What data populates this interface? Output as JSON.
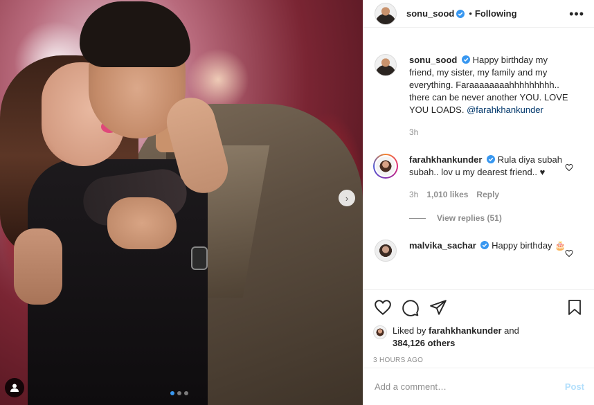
{
  "colors": {
    "link": "#00376b",
    "verified": "#3897f0",
    "post_button_disabled": "#b2dffc",
    "muted_text": "#8e8e8e"
  },
  "photo": {
    "carousel_dots": 3,
    "active_dot": 0,
    "next_icon": "chevron-right-icon",
    "tag_icon": "user-tag-icon"
  },
  "header": {
    "username": "sonu_sood",
    "separator": "•",
    "follow_status": "Following",
    "more_icon": "more-options-icon"
  },
  "caption": {
    "username": "sonu_sood",
    "text": "Happy birthday my friend, my sister, my family and my everything. Faraaaaaaaahhhhhhhhh.. there can be never another YOU. LOVE YOU LOADS.",
    "mention": "@farahkhankunder",
    "time": "3h"
  },
  "comments": [
    {
      "username": "farahkhankunder",
      "text": "Rula diya subah subah.. lov u my dearest friend.. ♥",
      "time": "3h",
      "likes": "1,010 likes",
      "reply_label": "Reply",
      "view_replies": "View replies (51)"
    },
    {
      "username": "malvika_sachar",
      "text": "Happy birthday 🎂"
    }
  ],
  "likes": {
    "prefix": "Liked by",
    "by_user": "farahkhankunder",
    "and": "and",
    "others": "384,126 others"
  },
  "timestamp": "3 HOURS AGO",
  "add_comment": {
    "placeholder": "Add a comment…",
    "post_label": "Post"
  }
}
